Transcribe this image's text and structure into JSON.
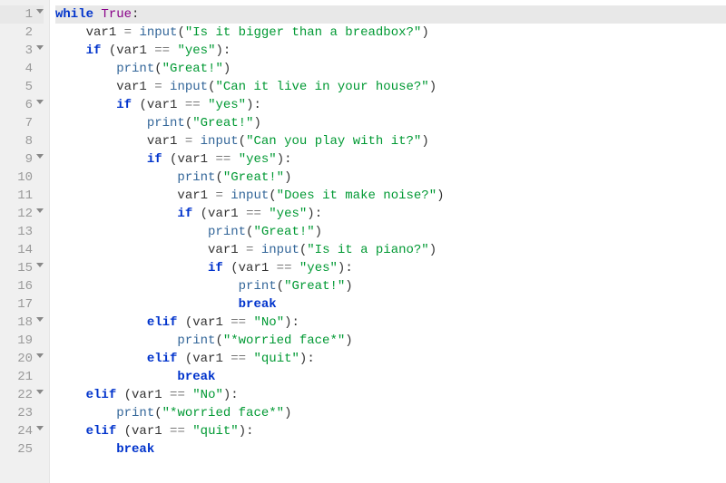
{
  "editor": {
    "lines": [
      {
        "num": "1",
        "fold": true,
        "hl": true,
        "indent": "",
        "tokens": [
          [
            "kw",
            "while"
          ],
          [
            " "
          ],
          [
            "bool",
            "True"
          ],
          [
            "punc",
            ":"
          ]
        ]
      },
      {
        "num": "2",
        "fold": false,
        "indent": "    ",
        "tokens": [
          [
            "id",
            "var1"
          ],
          [
            " "
          ],
          [
            "op",
            "="
          ],
          [
            " "
          ],
          [
            "bi",
            "input"
          ],
          [
            "punc",
            "("
          ],
          [
            "str",
            "\"Is it bigger than a breadbox?\""
          ],
          [
            "punc",
            ")"
          ]
        ]
      },
      {
        "num": "3",
        "fold": true,
        "indent": "    ",
        "tokens": [
          [
            "kw",
            "if"
          ],
          [
            " "
          ],
          [
            "punc",
            "("
          ],
          [
            "id",
            "var1"
          ],
          [
            " "
          ],
          [
            "op",
            "=="
          ],
          [
            " "
          ],
          [
            "str",
            "\"yes\""
          ],
          [
            "punc",
            ")"
          ],
          [
            "punc",
            ":"
          ]
        ]
      },
      {
        "num": "4",
        "fold": false,
        "indent": "        ",
        "tokens": [
          [
            "bi",
            "print"
          ],
          [
            "punc",
            "("
          ],
          [
            "str",
            "\"Great!\""
          ],
          [
            "punc",
            ")"
          ]
        ]
      },
      {
        "num": "5",
        "fold": false,
        "indent": "        ",
        "tokens": [
          [
            "id",
            "var1"
          ],
          [
            " "
          ],
          [
            "op",
            "="
          ],
          [
            " "
          ],
          [
            "bi",
            "input"
          ],
          [
            "punc",
            "("
          ],
          [
            "str",
            "\"Can it live in your house?\""
          ],
          [
            "punc",
            ")"
          ]
        ]
      },
      {
        "num": "6",
        "fold": true,
        "indent": "        ",
        "tokens": [
          [
            "kw",
            "if"
          ],
          [
            " "
          ],
          [
            "punc",
            "("
          ],
          [
            "id",
            "var1"
          ],
          [
            " "
          ],
          [
            "op",
            "=="
          ],
          [
            " "
          ],
          [
            "str",
            "\"yes\""
          ],
          [
            "punc",
            ")"
          ],
          [
            "punc",
            ":"
          ]
        ]
      },
      {
        "num": "7",
        "fold": false,
        "indent": "            ",
        "tokens": [
          [
            "bi",
            "print"
          ],
          [
            "punc",
            "("
          ],
          [
            "str",
            "\"Great!\""
          ],
          [
            "punc",
            ")"
          ]
        ]
      },
      {
        "num": "8",
        "fold": false,
        "indent": "            ",
        "tokens": [
          [
            "id",
            "var1"
          ],
          [
            " "
          ],
          [
            "op",
            "="
          ],
          [
            " "
          ],
          [
            "bi",
            "input"
          ],
          [
            "punc",
            "("
          ],
          [
            "str",
            "\"Can you play with it?\""
          ],
          [
            "punc",
            ")"
          ]
        ]
      },
      {
        "num": "9",
        "fold": true,
        "indent": "            ",
        "tokens": [
          [
            "kw",
            "if"
          ],
          [
            " "
          ],
          [
            "punc",
            "("
          ],
          [
            "id",
            "var1"
          ],
          [
            " "
          ],
          [
            "op",
            "=="
          ],
          [
            " "
          ],
          [
            "str",
            "\"yes\""
          ],
          [
            "punc",
            ")"
          ],
          [
            "punc",
            ":"
          ]
        ]
      },
      {
        "num": "10",
        "fold": false,
        "indent": "                ",
        "tokens": [
          [
            "bi",
            "print"
          ],
          [
            "punc",
            "("
          ],
          [
            "str",
            "\"Great!\""
          ],
          [
            "punc",
            ")"
          ]
        ]
      },
      {
        "num": "11",
        "fold": false,
        "indent": "                ",
        "tokens": [
          [
            "id",
            "var1"
          ],
          [
            " "
          ],
          [
            "op",
            "="
          ],
          [
            " "
          ],
          [
            "bi",
            "input"
          ],
          [
            "punc",
            "("
          ],
          [
            "str",
            "\"Does it make noise?\""
          ],
          [
            "punc",
            ")"
          ]
        ]
      },
      {
        "num": "12",
        "fold": true,
        "indent": "                ",
        "tokens": [
          [
            "kw",
            "if"
          ],
          [
            " "
          ],
          [
            "punc",
            "("
          ],
          [
            "id",
            "var1"
          ],
          [
            " "
          ],
          [
            "op",
            "=="
          ],
          [
            " "
          ],
          [
            "str",
            "\"yes\""
          ],
          [
            "punc",
            ")"
          ],
          [
            "punc",
            ":"
          ]
        ]
      },
      {
        "num": "13",
        "fold": false,
        "indent": "                    ",
        "tokens": [
          [
            "bi",
            "print"
          ],
          [
            "punc",
            "("
          ],
          [
            "str",
            "\"Great!\""
          ],
          [
            "punc",
            ")"
          ]
        ]
      },
      {
        "num": "14",
        "fold": false,
        "indent": "                    ",
        "tokens": [
          [
            "id",
            "var1"
          ],
          [
            " "
          ],
          [
            "op",
            "="
          ],
          [
            " "
          ],
          [
            "bi",
            "input"
          ],
          [
            "punc",
            "("
          ],
          [
            "str",
            "\"Is it a piano?\""
          ],
          [
            "punc",
            ")"
          ]
        ]
      },
      {
        "num": "15",
        "fold": true,
        "indent": "                    ",
        "tokens": [
          [
            "kw",
            "if"
          ],
          [
            " "
          ],
          [
            "punc",
            "("
          ],
          [
            "id",
            "var1"
          ],
          [
            " "
          ],
          [
            "op",
            "=="
          ],
          [
            " "
          ],
          [
            "str",
            "\"yes\""
          ],
          [
            "punc",
            ")"
          ],
          [
            "punc",
            ":"
          ]
        ]
      },
      {
        "num": "16",
        "fold": false,
        "indent": "                        ",
        "tokens": [
          [
            "bi",
            "print"
          ],
          [
            "punc",
            "("
          ],
          [
            "str",
            "\"Great!\""
          ],
          [
            "punc",
            ")"
          ]
        ]
      },
      {
        "num": "17",
        "fold": false,
        "indent": "                        ",
        "tokens": [
          [
            "kw",
            "break"
          ]
        ]
      },
      {
        "num": "18",
        "fold": true,
        "indent": "            ",
        "tokens": [
          [
            "kw",
            "elif"
          ],
          [
            " "
          ],
          [
            "punc",
            "("
          ],
          [
            "id",
            "var1"
          ],
          [
            " "
          ],
          [
            "op",
            "=="
          ],
          [
            " "
          ],
          [
            "str",
            "\"No\""
          ],
          [
            "punc",
            ")"
          ],
          [
            "punc",
            ":"
          ]
        ]
      },
      {
        "num": "19",
        "fold": false,
        "indent": "                ",
        "tokens": [
          [
            "bi",
            "print"
          ],
          [
            "punc",
            "("
          ],
          [
            "str",
            "\"*worried face*\""
          ],
          [
            "punc",
            ")"
          ]
        ]
      },
      {
        "num": "20",
        "fold": true,
        "indent": "            ",
        "tokens": [
          [
            "kw",
            "elif"
          ],
          [
            " "
          ],
          [
            "punc",
            "("
          ],
          [
            "id",
            "var1"
          ],
          [
            " "
          ],
          [
            "op",
            "=="
          ],
          [
            " "
          ],
          [
            "str",
            "\"quit\""
          ],
          [
            "punc",
            ")"
          ],
          [
            "punc",
            ":"
          ]
        ]
      },
      {
        "num": "21",
        "fold": false,
        "indent": "                ",
        "tokens": [
          [
            "kw",
            "break"
          ]
        ]
      },
      {
        "num": "22",
        "fold": true,
        "indent": "    ",
        "tokens": [
          [
            "kw",
            "elif"
          ],
          [
            " "
          ],
          [
            "punc",
            "("
          ],
          [
            "id",
            "var1"
          ],
          [
            " "
          ],
          [
            "op",
            "=="
          ],
          [
            " "
          ],
          [
            "str",
            "\"No\""
          ],
          [
            "punc",
            ")"
          ],
          [
            "punc",
            ":"
          ]
        ]
      },
      {
        "num": "23",
        "fold": false,
        "indent": "        ",
        "tokens": [
          [
            "bi",
            "print"
          ],
          [
            "punc",
            "("
          ],
          [
            "str",
            "\"*worried face*\""
          ],
          [
            "punc",
            ")"
          ]
        ]
      },
      {
        "num": "24",
        "fold": true,
        "indent": "    ",
        "tokens": [
          [
            "kw",
            "elif"
          ],
          [
            " "
          ],
          [
            "punc",
            "("
          ],
          [
            "id",
            "var1"
          ],
          [
            " "
          ],
          [
            "op",
            "=="
          ],
          [
            " "
          ],
          [
            "str",
            "\"quit\""
          ],
          [
            "punc",
            ")"
          ],
          [
            "punc",
            ":"
          ]
        ]
      },
      {
        "num": "25",
        "fold": false,
        "indent": "        ",
        "tokens": [
          [
            "kw",
            "break"
          ]
        ]
      }
    ]
  }
}
